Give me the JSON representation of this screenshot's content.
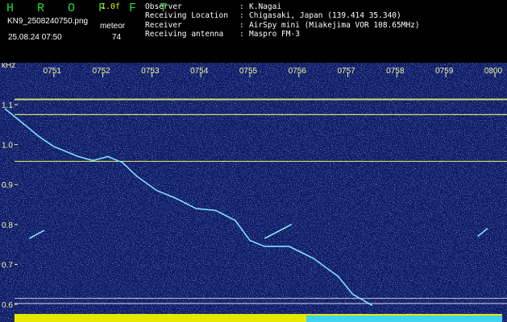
{
  "header": {
    "app_title": "H R O F F T",
    "version": "1.0f",
    "filename": "KN9_2508240750.png",
    "meteor_label": "meteor",
    "datetime": "25.08.24 07:50",
    "meteor_count": "74"
  },
  "info": [
    {
      "key": "Observer",
      "sep": ":",
      "value": "K.Nagai"
    },
    {
      "key": "Receiving Location",
      "sep": ":",
      "value": "Chigasaki, Japan (139.414 35.340)"
    },
    {
      "key": "Receiver",
      "sep": ":",
      "value": "AirSpy mini (Miakejima VOR 108.65MHz)"
    },
    {
      "key": "Receiving antenna",
      "sep": ":",
      "value": "Maspro FM-3"
    }
  ],
  "axes": {
    "y_unit": "kHz",
    "y_ticks": [
      "1.1",
      "1.0",
      "0.9",
      "0.8",
      "0.7",
      "0.6"
    ],
    "x_ticks": [
      "0751",
      "0752",
      "0753",
      "0754",
      "0755",
      "0756",
      "0757",
      "0758",
      "0759",
      "0800"
    ]
  },
  "colors": {
    "background": "#0d1a66",
    "trace": "#e8f070",
    "curve": "#7fe0ff",
    "label": "#f2f2a0",
    "title": "#22dd33"
  },
  "trace_lines_khz": [
    1.113,
    1.075,
    0.958,
    0.615,
    0.602
  ],
  "echo_trace": [
    {
      "min": 0.0,
      "khz": 1.09
    },
    {
      "min": 0.3,
      "khz": 1.06
    },
    {
      "min": 0.7,
      "khz": 1.02
    },
    {
      "min": 1.0,
      "khz": 0.995
    },
    {
      "min": 1.2,
      "khz": 0.985
    },
    {
      "min": 1.5,
      "khz": 0.97
    },
    {
      "min": 1.8,
      "khz": 0.96
    },
    {
      "min": 2.1,
      "khz": 0.97
    },
    {
      "min": 2.4,
      "khz": 0.955
    },
    {
      "min": 2.7,
      "khz": 0.92
    },
    {
      "min": 3.1,
      "khz": 0.885
    },
    {
      "min": 3.5,
      "khz": 0.865
    },
    {
      "min": 3.9,
      "khz": 0.84
    },
    {
      "min": 4.3,
      "khz": 0.835
    },
    {
      "min": 4.7,
      "khz": 0.81
    },
    {
      "min": 5.0,
      "khz": 0.76
    },
    {
      "min": 5.3,
      "khz": 0.745
    },
    {
      "min": 5.8,
      "khz": 0.745
    },
    {
      "min": 6.3,
      "khz": 0.715
    },
    {
      "min": 6.8,
      "khz": 0.67
    },
    {
      "min": 7.1,
      "khz": 0.625
    },
    {
      "min": 7.5,
      "khz": 0.597
    }
  ],
  "echo_pings": [
    {
      "min0": 0.5,
      "khz0": 0.765,
      "min1": 0.8,
      "khz1": 0.785
    },
    {
      "min0": 5.3,
      "khz0": 0.765,
      "min1": 5.85,
      "khz1": 0.8
    },
    {
      "min0": 9.65,
      "khz0": 0.77,
      "min1": 9.85,
      "khz1": 0.79
    }
  ]
}
